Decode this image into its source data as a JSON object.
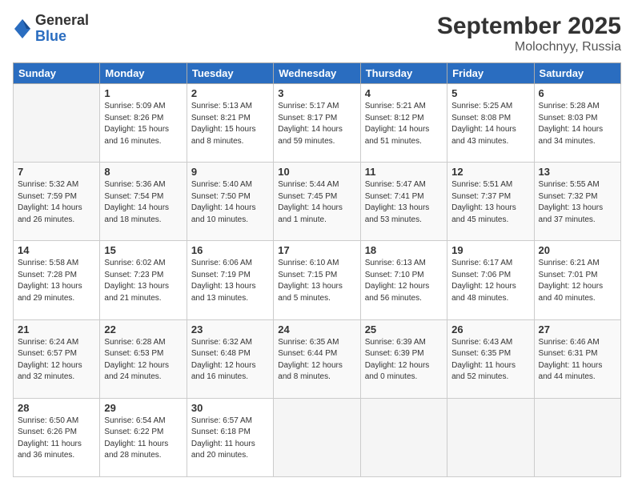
{
  "header": {
    "logo_general": "General",
    "logo_blue": "Blue",
    "month": "September 2025",
    "location": "Molochnyy, Russia"
  },
  "days_of_week": [
    "Sunday",
    "Monday",
    "Tuesday",
    "Wednesday",
    "Thursday",
    "Friday",
    "Saturday"
  ],
  "weeks": [
    [
      {
        "num": "",
        "info": ""
      },
      {
        "num": "1",
        "info": "Sunrise: 5:09 AM\nSunset: 8:26 PM\nDaylight: 15 hours\nand 16 minutes."
      },
      {
        "num": "2",
        "info": "Sunrise: 5:13 AM\nSunset: 8:21 PM\nDaylight: 15 hours\nand 8 minutes."
      },
      {
        "num": "3",
        "info": "Sunrise: 5:17 AM\nSunset: 8:17 PM\nDaylight: 14 hours\nand 59 minutes."
      },
      {
        "num": "4",
        "info": "Sunrise: 5:21 AM\nSunset: 8:12 PM\nDaylight: 14 hours\nand 51 minutes."
      },
      {
        "num": "5",
        "info": "Sunrise: 5:25 AM\nSunset: 8:08 PM\nDaylight: 14 hours\nand 43 minutes."
      },
      {
        "num": "6",
        "info": "Sunrise: 5:28 AM\nSunset: 8:03 PM\nDaylight: 14 hours\nand 34 minutes."
      }
    ],
    [
      {
        "num": "7",
        "info": "Sunrise: 5:32 AM\nSunset: 7:59 PM\nDaylight: 14 hours\nand 26 minutes."
      },
      {
        "num": "8",
        "info": "Sunrise: 5:36 AM\nSunset: 7:54 PM\nDaylight: 14 hours\nand 18 minutes."
      },
      {
        "num": "9",
        "info": "Sunrise: 5:40 AM\nSunset: 7:50 PM\nDaylight: 14 hours\nand 10 minutes."
      },
      {
        "num": "10",
        "info": "Sunrise: 5:44 AM\nSunset: 7:45 PM\nDaylight: 14 hours\nand 1 minute."
      },
      {
        "num": "11",
        "info": "Sunrise: 5:47 AM\nSunset: 7:41 PM\nDaylight: 13 hours\nand 53 minutes."
      },
      {
        "num": "12",
        "info": "Sunrise: 5:51 AM\nSunset: 7:37 PM\nDaylight: 13 hours\nand 45 minutes."
      },
      {
        "num": "13",
        "info": "Sunrise: 5:55 AM\nSunset: 7:32 PM\nDaylight: 13 hours\nand 37 minutes."
      }
    ],
    [
      {
        "num": "14",
        "info": "Sunrise: 5:58 AM\nSunset: 7:28 PM\nDaylight: 13 hours\nand 29 minutes."
      },
      {
        "num": "15",
        "info": "Sunrise: 6:02 AM\nSunset: 7:23 PM\nDaylight: 13 hours\nand 21 minutes."
      },
      {
        "num": "16",
        "info": "Sunrise: 6:06 AM\nSunset: 7:19 PM\nDaylight: 13 hours\nand 13 minutes."
      },
      {
        "num": "17",
        "info": "Sunrise: 6:10 AM\nSunset: 7:15 PM\nDaylight: 13 hours\nand 5 minutes."
      },
      {
        "num": "18",
        "info": "Sunrise: 6:13 AM\nSunset: 7:10 PM\nDaylight: 12 hours\nand 56 minutes."
      },
      {
        "num": "19",
        "info": "Sunrise: 6:17 AM\nSunset: 7:06 PM\nDaylight: 12 hours\nand 48 minutes."
      },
      {
        "num": "20",
        "info": "Sunrise: 6:21 AM\nSunset: 7:01 PM\nDaylight: 12 hours\nand 40 minutes."
      }
    ],
    [
      {
        "num": "21",
        "info": "Sunrise: 6:24 AM\nSunset: 6:57 PM\nDaylight: 12 hours\nand 32 minutes."
      },
      {
        "num": "22",
        "info": "Sunrise: 6:28 AM\nSunset: 6:53 PM\nDaylight: 12 hours\nand 24 minutes."
      },
      {
        "num": "23",
        "info": "Sunrise: 6:32 AM\nSunset: 6:48 PM\nDaylight: 12 hours\nand 16 minutes."
      },
      {
        "num": "24",
        "info": "Sunrise: 6:35 AM\nSunset: 6:44 PM\nDaylight: 12 hours\nand 8 minutes."
      },
      {
        "num": "25",
        "info": "Sunrise: 6:39 AM\nSunset: 6:39 PM\nDaylight: 12 hours\nand 0 minutes."
      },
      {
        "num": "26",
        "info": "Sunrise: 6:43 AM\nSunset: 6:35 PM\nDaylight: 11 hours\nand 52 minutes."
      },
      {
        "num": "27",
        "info": "Sunrise: 6:46 AM\nSunset: 6:31 PM\nDaylight: 11 hours\nand 44 minutes."
      }
    ],
    [
      {
        "num": "28",
        "info": "Sunrise: 6:50 AM\nSunset: 6:26 PM\nDaylight: 11 hours\nand 36 minutes."
      },
      {
        "num": "29",
        "info": "Sunrise: 6:54 AM\nSunset: 6:22 PM\nDaylight: 11 hours\nand 28 minutes."
      },
      {
        "num": "30",
        "info": "Sunrise: 6:57 AM\nSunset: 6:18 PM\nDaylight: 11 hours\nand 20 minutes."
      },
      {
        "num": "",
        "info": ""
      },
      {
        "num": "",
        "info": ""
      },
      {
        "num": "",
        "info": ""
      },
      {
        "num": "",
        "info": ""
      }
    ]
  ]
}
